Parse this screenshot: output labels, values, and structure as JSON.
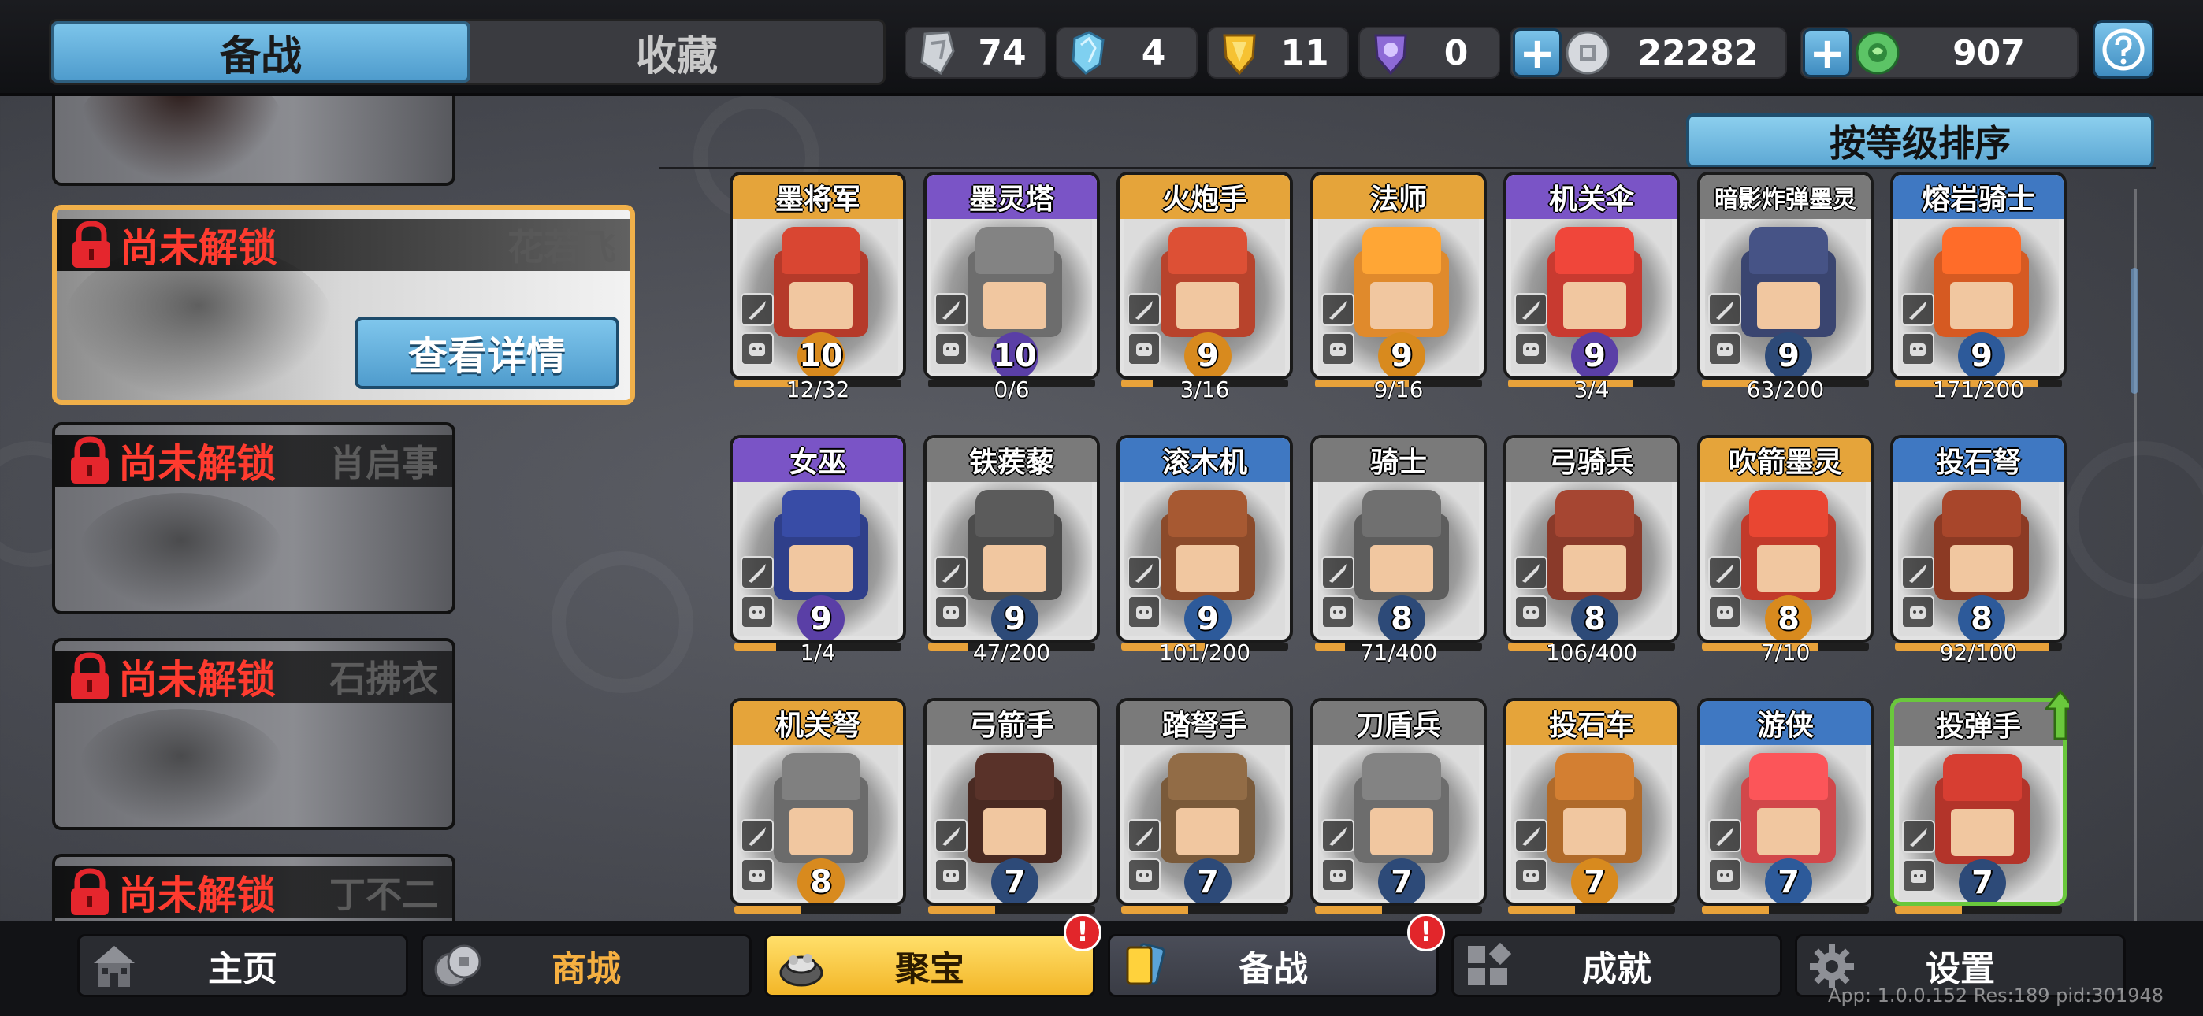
{
  "top": {
    "tabs": [
      {
        "label": "备战",
        "active": true
      },
      {
        "label": "收藏",
        "active": false
      }
    ],
    "resources": [
      {
        "icon": "silver-shard-icon",
        "value": "74"
      },
      {
        "icon": "blue-crystal-icon",
        "value": "4"
      },
      {
        "icon": "gold-shield-icon",
        "value": "11"
      },
      {
        "icon": "purple-gem-icon",
        "value": "0"
      },
      {
        "icon": "silver-coin-icon",
        "value": "22282"
      },
      {
        "icon": "jade-icon",
        "value": "907"
      }
    ],
    "help_label": "?"
  },
  "heroes": [
    {
      "locked_label": "尚未解锁",
      "name": "花若飞",
      "selected": true,
      "detail_label": "查看详情"
    },
    {
      "locked_label": "尚未解锁",
      "name": "肖启事",
      "selected": false
    },
    {
      "locked_label": "尚未解锁",
      "name": "石拂衣",
      "selected": false
    },
    {
      "locked_label": "尚未解锁",
      "name": "丁不二",
      "selected": false
    }
  ],
  "sort_label": "按等级排序",
  "units": [
    {
      "name": "墨将军",
      "rarity": "gold",
      "level": "10",
      "progress": "12/32",
      "ratio": 0.375,
      "color": "#b53a2a"
    },
    {
      "name": "墨灵塔",
      "rarity": "purple",
      "level": "10",
      "progress": "0/6",
      "ratio": 0.0,
      "color": "#6d6d6d"
    },
    {
      "name": "火炮手",
      "rarity": "gold",
      "level": "9",
      "progress": "3/16",
      "ratio": 0.19,
      "color": "#b8432c"
    },
    {
      "name": "法师",
      "rarity": "gold",
      "level": "9",
      "progress": "9/16",
      "ratio": 0.56,
      "color": "#e08a2c"
    },
    {
      "name": "机关伞",
      "rarity": "purple",
      "level": "9",
      "progress": "3/4",
      "ratio": 0.75,
      "color": "#c83a30"
    },
    {
      "name": "暗影炸弹墨灵",
      "rarity": "gray",
      "level": "9",
      "progress": "63/200",
      "ratio": 0.32,
      "color": "#3a4570"
    },
    {
      "name": "熔岩骑士",
      "rarity": "blue",
      "level": "9",
      "progress": "171/200",
      "ratio": 0.86,
      "color": "#d65a22"
    },
    {
      "name": "女巫",
      "rarity": "purple",
      "level": "9",
      "progress": "1/4",
      "ratio": 0.25,
      "color": "#2f3f8a"
    },
    {
      "name": "铁蒺藜",
      "rarity": "gray",
      "level": "9",
      "progress": "47/200",
      "ratio": 0.24,
      "color": "#4c4c4c"
    },
    {
      "name": "滚木机",
      "rarity": "blue",
      "level": "9",
      "progress": "101/200",
      "ratio": 0.5,
      "color": "#8b4a2a"
    },
    {
      "name": "骑士",
      "rarity": "gray",
      "level": "8",
      "progress": "71/400",
      "ratio": 0.18,
      "color": "#5d5d5d"
    },
    {
      "name": "弓骑兵",
      "rarity": "gray",
      "level": "8",
      "progress": "106/400",
      "ratio": 0.27,
      "color": "#8a3a2a"
    },
    {
      "name": "吹箭墨灵",
      "rarity": "gold",
      "level": "8",
      "progress": "7/10",
      "ratio": 0.7,
      "color": "#c23a2a"
    },
    {
      "name": "投石弩",
      "rarity": "blue",
      "level": "8",
      "progress": "92/100",
      "ratio": 0.92,
      "color": "#8c3a24"
    },
    {
      "name": "机关弩",
      "rarity": "gold",
      "level": "8",
      "progress": "",
      "ratio": 0.4,
      "color": "#6b6b6b"
    },
    {
      "name": "弓箭手",
      "rarity": "gray",
      "level": "7",
      "progress": "",
      "ratio": 0.4,
      "color": "#4a2a22"
    },
    {
      "name": "踏弩手",
      "rarity": "gray",
      "level": "7",
      "progress": "",
      "ratio": 0.4,
      "color": "#7a5a3a"
    },
    {
      "name": "刀盾兵",
      "rarity": "gray",
      "level": "7",
      "progress": "",
      "ratio": 0.4,
      "color": "#6d6d6d"
    },
    {
      "name": "投石车",
      "rarity": "gold",
      "level": "7",
      "progress": "",
      "ratio": 0.4,
      "color": "#b06a2a"
    },
    {
      "name": "游侠",
      "rarity": "blue",
      "level": "7",
      "progress": "",
      "ratio": 0.4,
      "color": "#d2474a"
    },
    {
      "name": "投弹手",
      "rarity": "gray",
      "level": "7",
      "progress": "",
      "ratio": 0.4,
      "color": "#b3342a",
      "upgradable": true
    }
  ],
  "nav": [
    {
      "label": "主页",
      "icon": "home-icon"
    },
    {
      "label": "商城",
      "icon": "coins-icon"
    },
    {
      "label": "聚宝",
      "icon": "treasure-bowl-icon",
      "badge": "!"
    },
    {
      "label": "备战",
      "icon": "cards-icon",
      "badge": "!",
      "active": true
    },
    {
      "label": "成就",
      "icon": "achievement-icon"
    },
    {
      "label": "设置",
      "icon": "gear-icon"
    }
  ],
  "version": "App: 1.0.0.152 Res:189 pid:301948"
}
